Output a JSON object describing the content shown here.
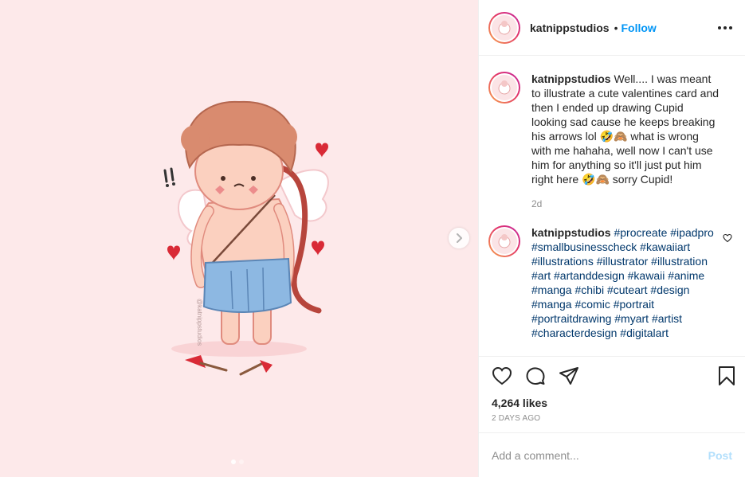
{
  "header": {
    "username": "katnippstudios",
    "separator": "•",
    "follow_label": "Follow"
  },
  "caption": {
    "username": "katnippstudios",
    "text": "Well.... I was meant to illustrate a cute valentines card and then I ended up drawing Cupid looking sad cause he keeps breaking his arrows lol 🤣🙈 what is wrong with me hahaha, well now I can't use him for anything so it'll just put him right here 🤣🙈 sorry Cupid!",
    "time": "2d"
  },
  "hashtag_comment": {
    "username": "katnippstudios",
    "text": "#procreate #ipadpro #smallbusinesscheck #kawaiiart #illustrations #illustrator #illustration #art #artanddesign #kawaii #anime #manga #chibi #cuteart #design #manga #comic #portrait #portraitdrawing #myart #artist #characterdesign #digitalart"
  },
  "stats": {
    "likes": "4,264 likes",
    "date": "2 DAYS AGO"
  },
  "comment_box": {
    "placeholder": "Add a comment...",
    "post_label": "Post"
  },
  "artwork": {
    "watermark": "@katnippstudios"
  },
  "carousel": {
    "current": 1,
    "total": 2
  },
  "icons": [
    "next-arrow-icon",
    "more-options-icon",
    "heart-icon",
    "comment-icon",
    "share-icon",
    "save-icon"
  ],
  "colors": {
    "background_pink": "#fde9ea",
    "link_blue": "#0095f6",
    "hashtag_blue": "#00376b",
    "post_disabled": "#b2dffc"
  }
}
